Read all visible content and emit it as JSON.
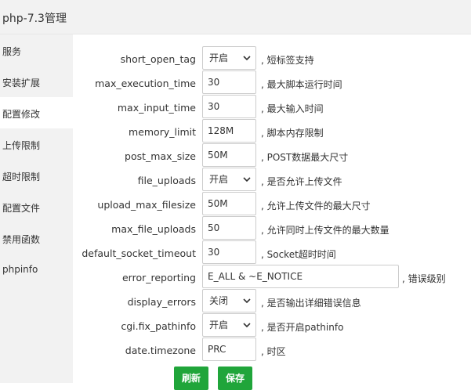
{
  "header": {
    "title": "php-7.3管理"
  },
  "sidebar": {
    "items": [
      {
        "label": "服务"
      },
      {
        "label": "安装扩展"
      },
      {
        "label": "配置修改",
        "active": true
      },
      {
        "label": "上传限制"
      },
      {
        "label": "超时限制"
      },
      {
        "label": "配置文件"
      },
      {
        "label": "禁用函数"
      },
      {
        "label": "phpinfo"
      }
    ]
  },
  "settings": {
    "rows": [
      {
        "name": "short_open_tag",
        "value": "开启",
        "control": "select",
        "desc": ", 短标签支持"
      },
      {
        "name": "max_execution_time",
        "value": "30",
        "control": "input",
        "desc": ", 最大脚本运行时间"
      },
      {
        "name": "max_input_time",
        "value": "30",
        "control": "input",
        "desc": ", 最大输入时间"
      },
      {
        "name": "memory_limit",
        "value": "128M",
        "control": "input",
        "desc": ", 脚本内存限制"
      },
      {
        "name": "post_max_size",
        "value": "50M",
        "control": "input",
        "desc": ", POST数据最大尺寸"
      },
      {
        "name": "file_uploads",
        "value": "开启",
        "control": "select",
        "desc": ", 是否允许上传文件"
      },
      {
        "name": "upload_max_filesize",
        "value": "50M",
        "control": "input",
        "desc": ", 允许上传文件的最大尺寸"
      },
      {
        "name": "max_file_uploads",
        "value": "50",
        "control": "input",
        "desc": ", 允许同时上传文件的最大数量"
      },
      {
        "name": "default_socket_timeout",
        "value": "30",
        "control": "input",
        "desc": ", Socket超时时间"
      },
      {
        "name": "error_reporting",
        "value": "E_ALL & ~E_NOTICE",
        "control": "input-wide",
        "desc": ", 错误级别"
      },
      {
        "name": "display_errors",
        "value": "关闭",
        "control": "select",
        "desc": ", 是否输出详细错误信息"
      },
      {
        "name": "cgi.fix_pathinfo",
        "value": "开启",
        "control": "select",
        "desc": ", 是否开启pathinfo"
      },
      {
        "name": "date.timezone",
        "value": "PRC",
        "control": "input",
        "desc": ", 时区"
      }
    ]
  },
  "actions": {
    "refresh_label": "刷新",
    "save_label": "保存"
  },
  "colors": {
    "accent": "#20a53a",
    "sidebar_bg": "#f2f2f2",
    "header_bg": "#f2f2f2"
  }
}
